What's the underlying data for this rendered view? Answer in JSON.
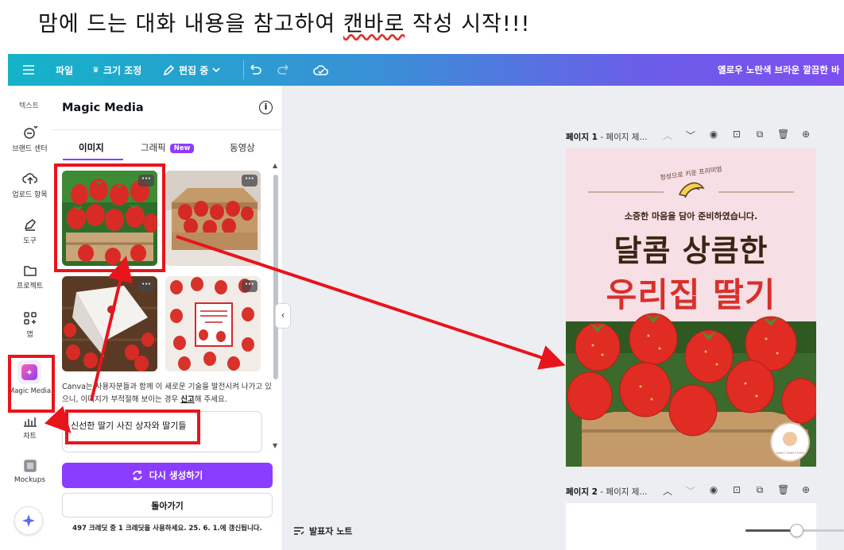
{
  "headline": {
    "text": "맘에 드는 대화 내용을 참고하여 ",
    "underlined": "캔바로",
    "text_after": " 작성 시작!!!"
  },
  "topbar": {
    "file_label": "파일",
    "resize_label": "크기 조정",
    "edit_label": "편집 중",
    "doc_title": "옐로우 노란색 브라운 깔끔한 바"
  },
  "rail": {
    "top_label": "텍스트",
    "items": [
      {
        "label": "브랜드 센터",
        "icon": "brand-kit-icon"
      },
      {
        "label": "업로드 항목",
        "icon": "upload-cloud-icon"
      },
      {
        "label": "도구",
        "icon": "pen-tool-icon"
      },
      {
        "label": "프로젝트",
        "icon": "folder-icon"
      },
      {
        "label": "앱",
        "icon": "apps-grid-icon"
      },
      {
        "label": "Magic Media",
        "icon": "magic-media-icon"
      },
      {
        "label": "차트",
        "icon": "chart-icon"
      },
      {
        "label": "Mockups",
        "icon": "mockups-icon"
      }
    ]
  },
  "panel": {
    "title": "Magic Media",
    "tabs": [
      {
        "label": "이미지"
      },
      {
        "label": "그래픽",
        "badge": "New"
      },
      {
        "label": "동영상"
      }
    ],
    "more_glyph": "···",
    "disclaimer_pre": "Canva는 사용자분들과 함께 이 새로운 기술을 발전시켜 나가고 있으니, 이미지가 부적절해 보이는 경우 ",
    "disclaimer_link": "신고",
    "disclaimer_post": "해 주세요.",
    "prompt": "신선한 딸기 사진 상자와 딸기들",
    "regenerate_label": "다시 생성하기",
    "back_label": "돌아가기",
    "credits": "497 크레딧 중 1 크레딧을 사용하세요. 25. 6. 1.에 갱신됩니다."
  },
  "canvas": {
    "page1_label": "페이지 1",
    "page1_title": " - 페이지 제...",
    "page2_label": "페이지 2",
    "page2_title": " - 페이지 제...",
    "notes_label": "발표자 노트"
  },
  "design": {
    "brand_text": "정성으로 키운 프리미엄",
    "tagline": "소중한 마음을 담아 준비하였습니다.",
    "headline1": "달콤 상큼한",
    "headline2": "우리집 딸기",
    "seal_text": "SWEET FARM STORY"
  },
  "colors": {
    "accent": "#8b3dff",
    "annotation_red": "#e8141b",
    "design_bg": "#f7dfe6",
    "headline_dark": "#3b2412",
    "headline_red": "#d8302a"
  }
}
